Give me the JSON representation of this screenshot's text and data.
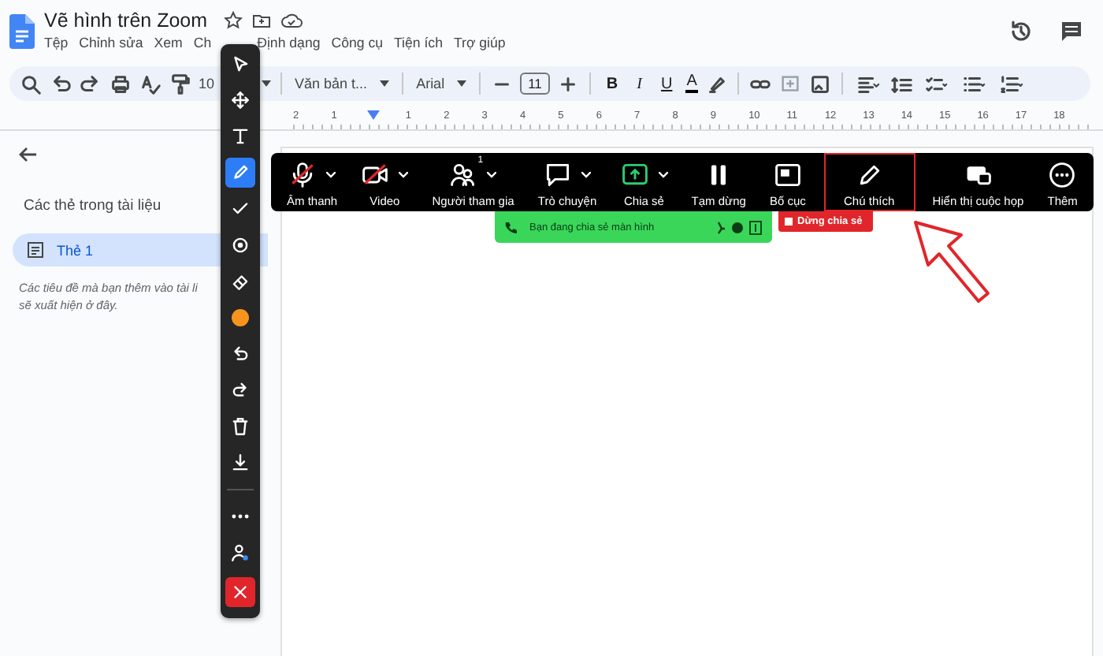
{
  "document": {
    "title": "Vẽ hình trên Zoom"
  },
  "menu": [
    "Tệp",
    "Chỉnh sửa",
    "Xem",
    "Ch",
    "Định dạng",
    "Công cụ",
    "Tiện ích",
    "Trợ giúp"
  ],
  "toolbar_groups": [
    [
      {
        "kind": "search"
      },
      {
        "kind": "undo"
      },
      {
        "kind": "redo"
      },
      {
        "kind": "print"
      },
      {
        "kind": "spellcheck"
      },
      {
        "kind": "paint-format"
      },
      {
        "kind": "dropdown",
        "text": "10"
      }
    ],
    [
      {
        "kind": "dropdown",
        "text": "Văn bản t..."
      }
    ],
    [
      {
        "kind": "dropdown",
        "text": "Arial"
      }
    ],
    [
      {
        "kind": "minus"
      },
      {
        "kind": "size",
        "text": "11"
      },
      {
        "kind": "plus"
      }
    ],
    [
      {
        "kind": "bold",
        "text": "B"
      },
      {
        "kind": "italic",
        "text": "I"
      },
      {
        "kind": "underline",
        "text": "U"
      },
      {
        "kind": "text-color",
        "text": "A"
      },
      {
        "kind": "highlighter"
      }
    ],
    [
      {
        "kind": "link"
      },
      {
        "kind": "add-comment"
      },
      {
        "kind": "image"
      }
    ],
    [
      {
        "kind": "align"
      },
      {
        "kind": "line-spacing"
      },
      {
        "kind": "checklist"
      },
      {
        "kind": "bullets"
      },
      {
        "kind": "numbered"
      }
    ]
  ],
  "ruler": [
    "2",
    "1",
    "1",
    "2",
    "3",
    "4",
    "5",
    "6",
    "7",
    "8",
    "9",
    "10",
    "11",
    "12",
    "13",
    "14",
    "15",
    "16",
    "17",
    "18"
  ],
  "sidebar": {
    "heading": "Các thẻ trong tài liệu",
    "tabs": [
      {
        "label": "Thẻ 1",
        "selected": true
      }
    ],
    "hint_lines": [
      "Các tiêu đề mà bạn thêm vào tài li",
      "sẽ xuất hiện ở đây."
    ]
  },
  "zoom_toolbar": [
    {
      "kind": "mic",
      "label": "Âm thanh",
      "muted": true,
      "caret": true,
      "selected": false
    },
    {
      "kind": "video",
      "label": "Video",
      "muted": true,
      "caret": true,
      "selected": false
    },
    {
      "kind": "participants",
      "label": "Người tham gia",
      "badge": "1",
      "caret": true,
      "selected": false
    },
    {
      "kind": "chat",
      "label": "Trò chuyện",
      "caret": true,
      "selected": false
    },
    {
      "kind": "share",
      "label": "Chia sẻ",
      "caret": true,
      "selected": false
    },
    {
      "kind": "pause",
      "label": "Tạm dừng",
      "caret": false,
      "selected": false
    },
    {
      "kind": "layout",
      "label": "Bố cục",
      "caret": false,
      "selected": false
    },
    {
      "kind": "annotate",
      "label": "Chú thích",
      "caret": false,
      "selected": true
    },
    {
      "kind": "meeting-view",
      "label": "Hiển thị cuộc họp",
      "caret": false,
      "selected": false
    },
    {
      "kind": "more",
      "label": "Thêm",
      "caret": false,
      "selected": false
    }
  ],
  "share_banner": {
    "text": "Bạn đang chia sẻ màn hình",
    "stop_button": "Dừng chia sẻ"
  },
  "annotation_tools": [
    {
      "kind": "pointer",
      "selected": false
    },
    {
      "kind": "move",
      "selected": false
    },
    {
      "kind": "text",
      "selected": false
    },
    {
      "kind": "pen",
      "selected": true
    },
    {
      "kind": "check",
      "selected": false
    },
    {
      "kind": "stamp",
      "selected": false
    },
    {
      "kind": "eraser",
      "selected": false
    },
    {
      "kind": "color",
      "color": "#f7941d",
      "selected": false
    },
    {
      "kind": "undo",
      "selected": false
    },
    {
      "kind": "redo",
      "selected": false
    },
    {
      "kind": "trash",
      "selected": false
    },
    {
      "kind": "download",
      "selected": false
    },
    {
      "kind": "divider"
    },
    {
      "kind": "more",
      "selected": false
    },
    {
      "kind": "user-settings",
      "selected": false
    },
    {
      "kind": "close",
      "selected": false
    }
  ]
}
